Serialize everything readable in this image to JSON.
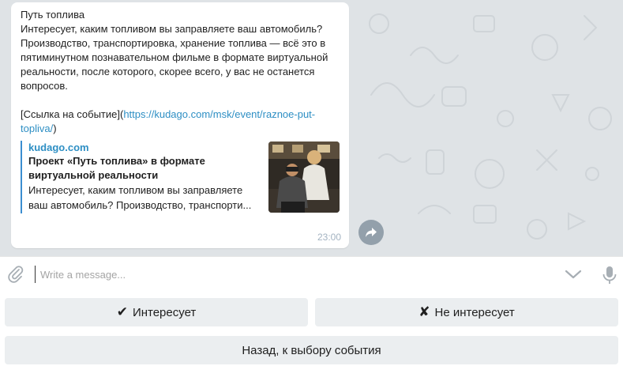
{
  "message": {
    "title": "Путь топлива",
    "body": "Интересует, каким топливом вы заправляете ваш автомобиль? Производство, транспортировка, хранение топлива — всё это в пятиминутном познавательном фильме в формате виртуальной реальности, после которого, скорее всего, у вас не останется вопросов.",
    "link_prefix": "[Ссылка на событие](",
    "link_url": "https://kudago.com/msk/event/raznoe-put-toplivа/",
    "link_suffix": ")",
    "time": "23:00"
  },
  "preview": {
    "site": "kudago.com",
    "title": "Проект «Путь топлива» в формате виртуальной  реальности",
    "description": "Интересует, каким топливом вы заправляете ваш автомобиль? Производство, транспорти..."
  },
  "composer": {
    "placeholder": "Write a message..."
  },
  "keyboard": {
    "yes_mark": "✔",
    "yes_label": "Интересует",
    "no_mark": "✘",
    "no_label": "Не интересует",
    "back_label": "Назад, к выбору события"
  },
  "icons": {
    "attach": "paperclip-icon",
    "forward": "share-arrow-icon",
    "keyboard_toggle": "chevron-down-icon",
    "mic": "microphone-icon"
  },
  "colors": {
    "chat_background": "#dfe3e6",
    "link": "#2e8fc4",
    "preview_bar": "#3b8ed0",
    "button_background": "#ebeef0",
    "time": "#a3b3c1"
  }
}
